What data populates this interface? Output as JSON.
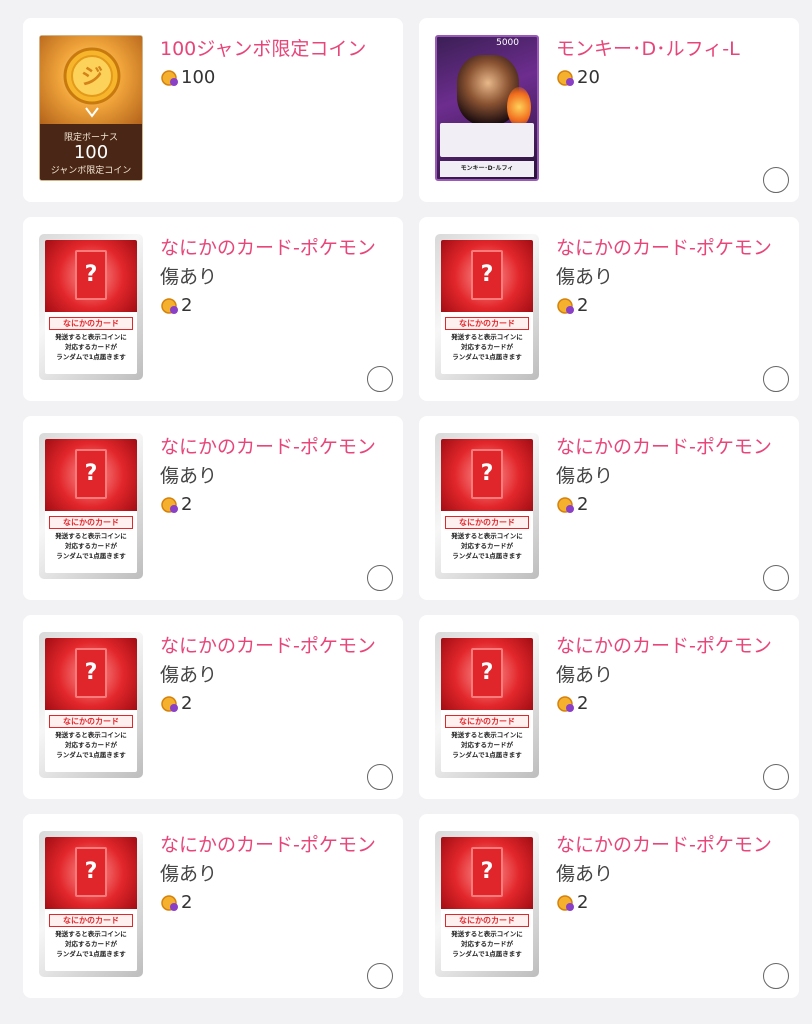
{
  "items": [
    {
      "name": "100ジャンボ限定コイン",
      "condition": "",
      "price": "100",
      "thumb": "bonus-coin",
      "selectable": false
    },
    {
      "name": "モンキー･D･ルフィ-L",
      "condition": "",
      "price": "20",
      "thumb": "luffy-card",
      "selectable": true
    },
    {
      "name": "なにかのカード-ポケモン",
      "condition": "傷あり",
      "price": "2",
      "thumb": "mystery-card",
      "selectable": true
    },
    {
      "name": "なにかのカード-ポケモン",
      "condition": "傷あり",
      "price": "2",
      "thumb": "mystery-card",
      "selectable": true
    },
    {
      "name": "なにかのカード-ポケモン",
      "condition": "傷あり",
      "price": "2",
      "thumb": "mystery-card",
      "selectable": true
    },
    {
      "name": "なにかのカード-ポケモン",
      "condition": "傷あり",
      "price": "2",
      "thumb": "mystery-card",
      "selectable": true
    },
    {
      "name": "なにかのカード-ポケモン",
      "condition": "傷あり",
      "price": "2",
      "thumb": "mystery-card",
      "selectable": true
    },
    {
      "name": "なにかのカード-ポケモン",
      "condition": "傷あり",
      "price": "2",
      "thumb": "mystery-card",
      "selectable": true
    },
    {
      "name": "なにかのカード-ポケモン",
      "condition": "傷あり",
      "price": "2",
      "thumb": "mystery-card",
      "selectable": true
    },
    {
      "name": "なにかのカード-ポケモン",
      "condition": "傷あり",
      "price": "2",
      "thumb": "mystery-card",
      "selectable": true
    }
  ],
  "bonus_card": {
    "label": "限定ボーナス",
    "amount": "100",
    "sub": "ジャンボ限定コイン"
  },
  "luffy_card": {
    "cost": "5000",
    "card_name": "モンキー･D･ルフィ"
  },
  "mystery_card": {
    "title": "なにかのカード",
    "desc_line1": "発送すると表示コインに",
    "desc_line2": "対応するカードが",
    "desc_line3": "ランダムで1点届きます"
  },
  "colors": {
    "accent": "#e8457a",
    "background": "#f2f2f4"
  },
  "icons": {
    "price": "coin-icon",
    "select": "radio-circle-icon"
  }
}
